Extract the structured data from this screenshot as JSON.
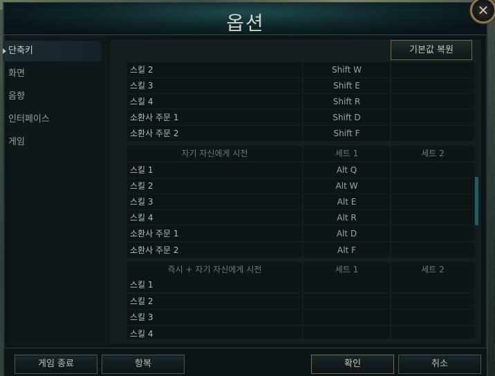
{
  "window": {
    "title": "옵션",
    "close_label": "✕"
  },
  "sidebar": {
    "items": [
      {
        "label": "단축키",
        "active": true
      },
      {
        "label": "화면",
        "active": false
      },
      {
        "label": "음향",
        "active": false
      },
      {
        "label": "인터페이스",
        "active": false
      },
      {
        "label": "게임",
        "active": false
      }
    ]
  },
  "panel": {
    "reset_label": "기본값 복원"
  },
  "rows": [
    {
      "name": "스킬 2",
      "set1": "Shift W",
      "set2": ""
    },
    {
      "name": "스킬 3",
      "set1": "Shift E",
      "set2": ""
    },
    {
      "name": "스킬 4",
      "set1": "Shift R",
      "set2": ""
    },
    {
      "name": "소환사 주문 1",
      "set1": "Shift D",
      "set2": ""
    },
    {
      "name": "소환사 주문 2",
      "set1": "Shift F",
      "set2": ""
    },
    {
      "header": true,
      "name": "자기 자신에게 시전",
      "set1": "세트 1",
      "set2": "세트 2"
    },
    {
      "name": "스킬 1",
      "set1": "Alt Q",
      "set2": ""
    },
    {
      "name": "스킬 2",
      "set1": "Alt W",
      "set2": ""
    },
    {
      "name": "스킬 3",
      "set1": "Alt E",
      "set2": ""
    },
    {
      "name": "스킬 4",
      "set1": "Alt R",
      "set2": ""
    },
    {
      "name": "소환사 주문 1",
      "set1": "Alt D",
      "set2": ""
    },
    {
      "name": "소환사 주문 2",
      "set1": "Alt F",
      "set2": ""
    },
    {
      "header": true,
      "name": "즉시 + 자기 자신에게 시전",
      "set1": "세트 1",
      "set2": "세트 2"
    },
    {
      "name": "스킬 1",
      "set1": "",
      "set2": ""
    },
    {
      "name": "스킬 2",
      "set1": "",
      "set2": ""
    },
    {
      "name": "스킬 3",
      "set1": "",
      "set2": ""
    },
    {
      "name": "스킬 4",
      "set1": "",
      "set2": ""
    }
  ],
  "footer": {
    "exit_label": "게임 종료",
    "surrender_label": "항복",
    "ok_label": "확인",
    "cancel_label": "취소"
  }
}
